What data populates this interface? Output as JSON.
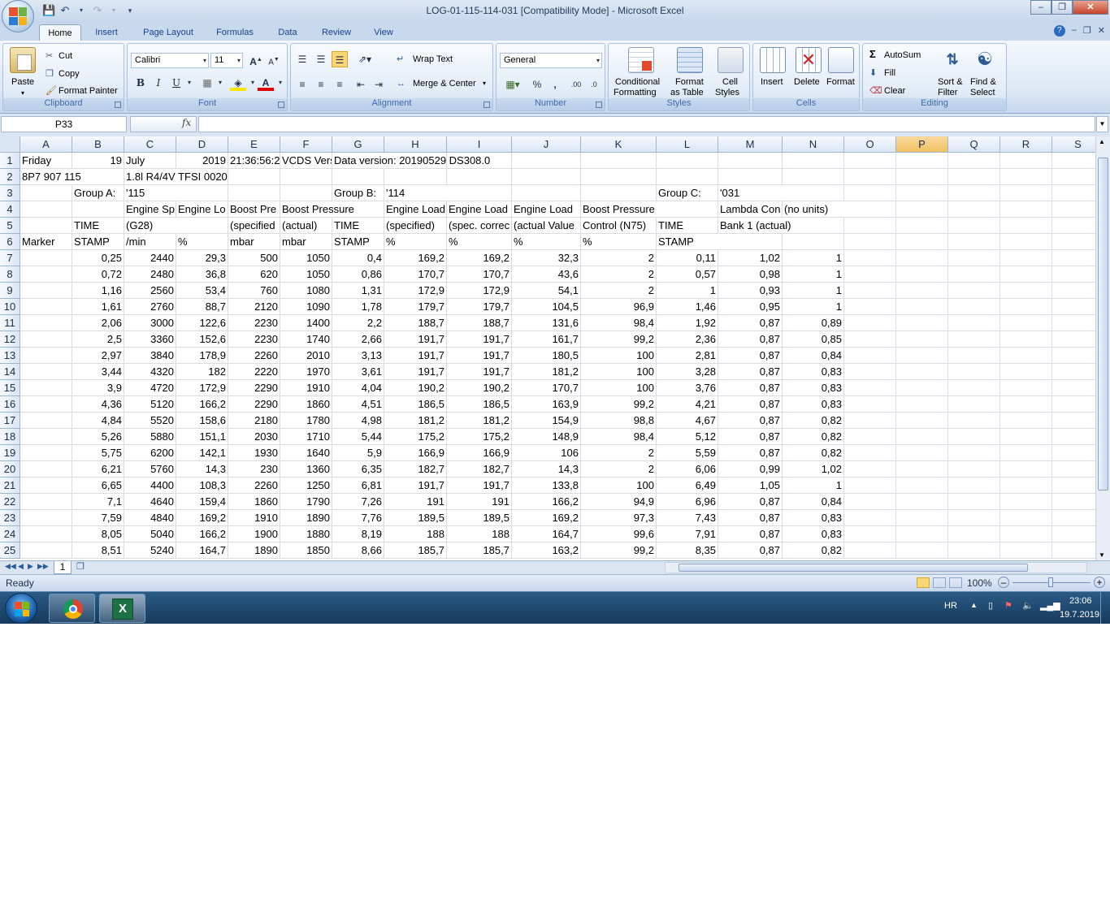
{
  "window": {
    "title": "LOG-01-115-114-031  [Compatibility Mode] - Microsoft Excel"
  },
  "tabs": [
    "Home",
    "Insert",
    "Page Layout",
    "Formulas",
    "Data",
    "Review",
    "View"
  ],
  "ribbon": {
    "clipboard": {
      "label": "Clipboard",
      "paste": "Paste",
      "cut": "Cut",
      "copy": "Copy",
      "format_painter": "Format Painter"
    },
    "font": {
      "label": "Font",
      "family": "Calibri",
      "size": "11",
      "bold": "B",
      "italic": "I",
      "underline": "U"
    },
    "alignment": {
      "label": "Alignment",
      "wrap_text": "Wrap Text",
      "merge_center": "Merge & Center"
    },
    "number": {
      "label": "Number",
      "format": "General",
      "percent": "%",
      "comma": ","
    },
    "styles": {
      "label": "Styles",
      "conditional": "Conditional",
      "conditional2": "Formatting",
      "format_table": "Format",
      "format_table2": "as Table",
      "cell_styles": "Cell",
      "cell_styles2": "Styles"
    },
    "cells": {
      "label": "Cells",
      "insert": "Insert",
      "delete": "Delete",
      "format": "Format"
    },
    "editing": {
      "label": "Editing",
      "autosum": "AutoSum",
      "fill": "Fill",
      "clear": "Clear",
      "sort": "Sort &",
      "sort2": "Filter",
      "find": "Find &",
      "find2": "Select"
    }
  },
  "formula_bar": {
    "name_box": "P33",
    "fx": "fx",
    "value": ""
  },
  "columns": [
    "A",
    "B",
    "C",
    "D",
    "E",
    "F",
    "G",
    "H",
    "I",
    "J",
    "K",
    "L",
    "M",
    "N",
    "O",
    "P",
    "Q",
    "R",
    "S"
  ],
  "selected_column": "P",
  "rows": [
    [
      "Friday",
      "19",
      "July",
      "2019",
      "21:36:56:2",
      "VCDS Vers",
      "Data version: 20190529 DS308.0",
      "",
      "",
      "",
      "",
      "",
      "",
      ""
    ],
    [
      "8P7 907 115",
      "",
      "1.8l R4/4V TFSI    0020",
      "",
      "",
      "",
      "",
      "",
      "",
      "",
      "",
      "",
      "",
      ""
    ],
    [
      "",
      "Group A:",
      "'115",
      "",
      "",
      "",
      "Group B:",
      "'114",
      "",
      "",
      "",
      "Group C:",
      "'031",
      ""
    ],
    [
      "",
      "",
      "Engine Sp",
      "Engine Lo",
      "Boost Pre",
      "Boost Pressure",
      "",
      "Engine Load",
      "Engine Load",
      "Engine Load",
      "Boost Pressure",
      "",
      "Lambda Con",
      "(no units)"
    ],
    [
      "",
      "TIME",
      "(G28)",
      "",
      "(specified",
      "(actual)",
      "TIME",
      "(specified)",
      "(spec. correc",
      "(actual Value",
      "Control (N75)",
      "TIME",
      "Bank 1 (actual)",
      ""
    ],
    [
      "Marker",
      "STAMP",
      "/min",
      "%",
      "mbar",
      "mbar",
      "STAMP",
      "%",
      "%",
      "%",
      "%",
      "STAMP",
      "",
      ""
    ],
    [
      "",
      "0,25",
      "2440",
      "29,3",
      "500",
      "1050",
      "0,4",
      "169,2",
      "169,2",
      "32,3",
      "2",
      "0,11",
      "1,02",
      "1"
    ],
    [
      "",
      "0,72",
      "2480",
      "36,8",
      "620",
      "1050",
      "0,86",
      "170,7",
      "170,7",
      "43,6",
      "2",
      "0,57",
      "0,98",
      "1"
    ],
    [
      "",
      "1,16",
      "2560",
      "53,4",
      "760",
      "1080",
      "1,31",
      "172,9",
      "172,9",
      "54,1",
      "2",
      "1",
      "0,93",
      "1"
    ],
    [
      "",
      "1,61",
      "2760",
      "88,7",
      "2120",
      "1090",
      "1,78",
      "179,7",
      "179,7",
      "104,5",
      "96,9",
      "1,46",
      "0,95",
      "1"
    ],
    [
      "",
      "2,06",
      "3000",
      "122,6",
      "2230",
      "1400",
      "2,2",
      "188,7",
      "188,7",
      "131,6",
      "98,4",
      "1,92",
      "0,87",
      "0,89"
    ],
    [
      "",
      "2,5",
      "3360",
      "152,6",
      "2230",
      "1740",
      "2,66",
      "191,7",
      "191,7",
      "161,7",
      "99,2",
      "2,36",
      "0,87",
      "0,85"
    ],
    [
      "",
      "2,97",
      "3840",
      "178,9",
      "2260",
      "2010",
      "3,13",
      "191,7",
      "191,7",
      "180,5",
      "100",
      "2,81",
      "0,87",
      "0,84"
    ],
    [
      "",
      "3,44",
      "4320",
      "182",
      "2220",
      "1970",
      "3,61",
      "191,7",
      "191,7",
      "181,2",
      "100",
      "3,28",
      "0,87",
      "0,83"
    ],
    [
      "",
      "3,9",
      "4720",
      "172,9",
      "2290",
      "1910",
      "4,04",
      "190,2",
      "190,2",
      "170,7",
      "100",
      "3,76",
      "0,87",
      "0,83"
    ],
    [
      "",
      "4,36",
      "5120",
      "166,2",
      "2290",
      "1860",
      "4,51",
      "186,5",
      "186,5",
      "163,9",
      "99,2",
      "4,21",
      "0,87",
      "0,83"
    ],
    [
      "",
      "4,84",
      "5520",
      "158,6",
      "2180",
      "1780",
      "4,98",
      "181,2",
      "181,2",
      "154,9",
      "98,8",
      "4,67",
      "0,87",
      "0,82"
    ],
    [
      "",
      "5,26",
      "5880",
      "151,1",
      "2030",
      "1710",
      "5,44",
      "175,2",
      "175,2",
      "148,9",
      "98,4",
      "5,12",
      "0,87",
      "0,82"
    ],
    [
      "",
      "5,75",
      "6200",
      "142,1",
      "1930",
      "1640",
      "5,9",
      "166,9",
      "166,9",
      "106",
      "2",
      "5,59",
      "0,87",
      "0,82"
    ],
    [
      "",
      "6,21",
      "5760",
      "14,3",
      "230",
      "1360",
      "6,35",
      "182,7",
      "182,7",
      "14,3",
      "2",
      "6,06",
      "0,99",
      "1,02"
    ],
    [
      "",
      "6,65",
      "4400",
      "108,3",
      "2260",
      "1250",
      "6,81",
      "191,7",
      "191,7",
      "133,8",
      "100",
      "6,49",
      "1,05",
      "1"
    ],
    [
      "",
      "7,1",
      "4640",
      "159,4",
      "1860",
      "1790",
      "7,26",
      "191",
      "191",
      "166,2",
      "94,9",
      "6,96",
      "0,87",
      "0,84"
    ],
    [
      "",
      "7,59",
      "4840",
      "169,2",
      "1910",
      "1890",
      "7,76",
      "189,5",
      "189,5",
      "169,2",
      "97,3",
      "7,43",
      "0,87",
      "0,83"
    ],
    [
      "",
      "8,05",
      "5040",
      "166,2",
      "1900",
      "1880",
      "8,19",
      "188",
      "188",
      "164,7",
      "99,6",
      "7,91",
      "0,87",
      "0,83"
    ],
    [
      "",
      "8,51",
      "5240",
      "164,7",
      "1890",
      "1850",
      "8,66",
      "185,7",
      "185,7",
      "163,2",
      "99,2",
      "8,35",
      "0,87",
      "0,82"
    ]
  ],
  "sheet_tab": "1",
  "status": {
    "text": "Ready",
    "zoom": "100%"
  },
  "taskbar": {
    "lang": "HR",
    "time": "23:06",
    "date": "19.7.2019."
  }
}
